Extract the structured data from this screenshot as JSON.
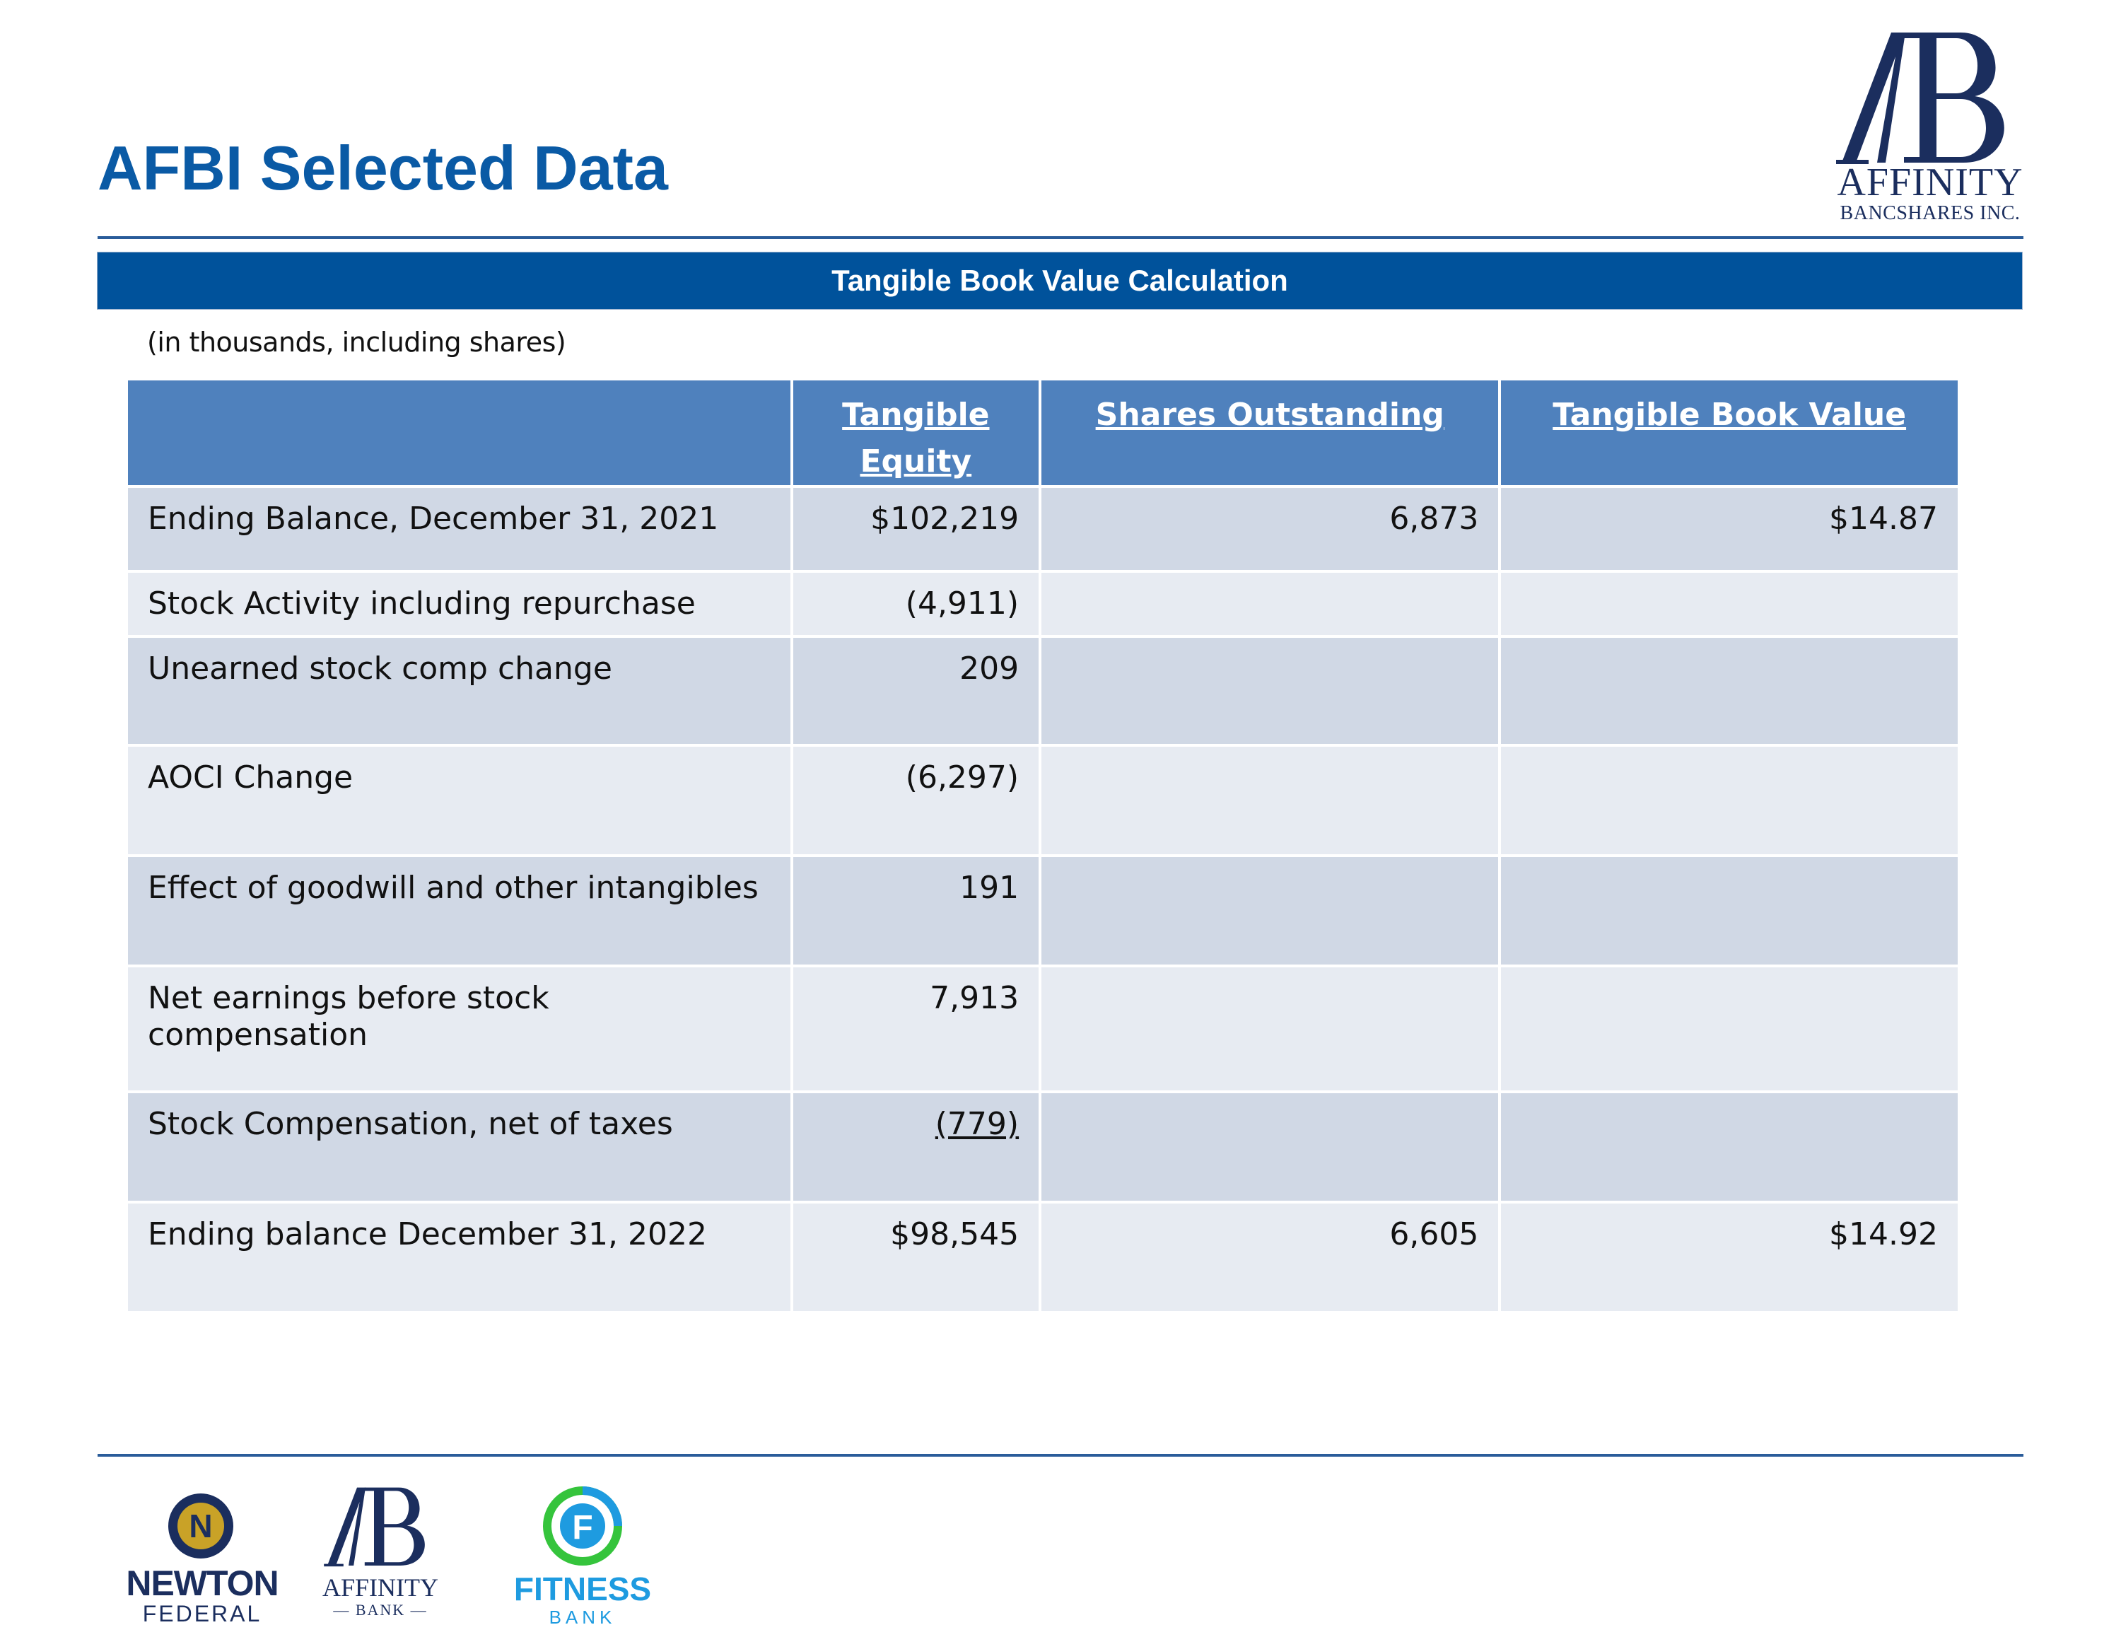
{
  "header": {
    "title": "AFBI Selected Data",
    "logo": {
      "name": "ab-monogram-icon",
      "line1": "AFFINITY",
      "line2": "BANCSHARES INC."
    }
  },
  "section": {
    "title": "Tangible Book Value Calculation",
    "note": "(in thousands, including shares)"
  },
  "table": {
    "headers": [
      "",
      "Tangible Equity",
      "Shares Outstanding",
      "Tangible Book Value"
    ],
    "header_equity_line1": "Tangible",
    "header_equity_line2": "Equity",
    "rows": [
      {
        "label": "Ending Balance, December 31, 2021",
        "equity": "$102,219",
        "shares": "6,873",
        "tbv": "$14.87"
      },
      {
        "label": "Stock Activity including repurchase",
        "equity": "(4,911)",
        "shares": "",
        "tbv": ""
      },
      {
        "label": "Unearned stock comp change",
        "equity": "209",
        "shares": "",
        "tbv": ""
      },
      {
        "label": "AOCI Change",
        "equity": "(6,297)",
        "shares": "",
        "tbv": ""
      },
      {
        "label": "Effect of goodwill and other intangibles",
        "equity": "191",
        "shares": "",
        "tbv": ""
      },
      {
        "label": "Net earnings before stock compensation",
        "equity": "7,913",
        "shares": "",
        "tbv": ""
      },
      {
        "label": "Stock Compensation, net of taxes",
        "equity": "(779)",
        "shares": "",
        "tbv": ""
      },
      {
        "label": "Ending balance December 31, 2022",
        "equity": "$98,545",
        "shares": "6,605",
        "tbv": "$14.92"
      }
    ]
  },
  "footer": {
    "brands": [
      {
        "name": "newton-federal-logo",
        "line1": "NEWTON",
        "line2": "FEDERAL",
        "mark": "N"
      },
      {
        "name": "affinity-bank-logo",
        "line1": "AFFINITY",
        "line2": "— BANK —"
      },
      {
        "name": "fitness-bank-logo",
        "line1": "FITNESS",
        "line2": "BANK",
        "mark": "F"
      }
    ]
  },
  "colors": {
    "title": "#0a5aa5",
    "section_bar": "#00529b",
    "table_header": "#4f81bd",
    "row_dark": "#d0d8e5",
    "row_light": "#e7ebf2",
    "navy": "#1b2e5e"
  }
}
